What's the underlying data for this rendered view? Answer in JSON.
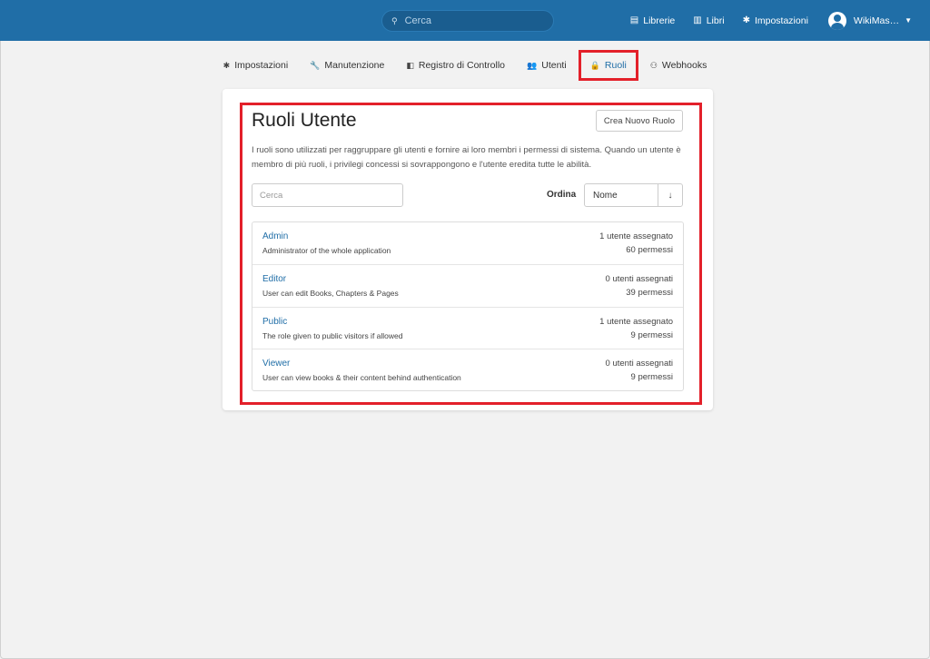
{
  "header": {
    "search_placeholder": "Cerca",
    "nav": [
      {
        "label": "Librerie",
        "icon": "library-icon",
        "glyph": "▤"
      },
      {
        "label": "Libri",
        "icon": "books-icon",
        "glyph": "▥"
      },
      {
        "label": "Impostazioni",
        "icon": "gear-icon",
        "glyph": "✱"
      }
    ],
    "user_name": "WikiMas…"
  },
  "subnav": [
    {
      "label": "Impostazioni",
      "icon": "gear-icon",
      "glyph": "✱"
    },
    {
      "label": "Manutenzione",
      "icon": "wrench-icon",
      "glyph": "🔧"
    },
    {
      "label": "Registro di Controllo",
      "icon": "audit-log-icon",
      "glyph": "◧"
    },
    {
      "label": "Utenti",
      "icon": "users-icon",
      "glyph": "👥"
    },
    {
      "label": "Ruoli",
      "icon": "lock-icon",
      "glyph": "🔒"
    },
    {
      "label": "Webhooks",
      "icon": "webhook-icon",
      "glyph": "⚇"
    }
  ],
  "page": {
    "title": "Ruoli Utente",
    "create_button": "Crea Nuovo Ruolo",
    "description": "I ruoli sono utilizzati per raggruppare gli utenti e fornire ai loro membri i permessi di sistema. Quando un utente è membro di più ruoli, i privilegi concessi si sovrappongono e l'utente eredita tutte le abilità.",
    "filter_placeholder": "Cerca",
    "sort_label": "Ordina",
    "sort_value": "Nome",
    "sort_direction": "↓"
  },
  "roles": [
    {
      "name": "Admin",
      "description": "Administrator of the whole application",
      "users": "1 utente assegnato",
      "permissions": "60 permessi"
    },
    {
      "name": "Editor",
      "description": "User can edit Books, Chapters & Pages",
      "users": "0 utenti assegnati",
      "permissions": "39 permessi"
    },
    {
      "name": "Public",
      "description": "The role given to public visitors if allowed",
      "users": "1 utente assegnato",
      "permissions": "9 permessi"
    },
    {
      "name": "Viewer",
      "description": "User can view books & their content behind authentication",
      "users": "0 utenti assegnati",
      "permissions": "9 permessi"
    }
  ],
  "colors": {
    "header": "#206ea7",
    "link": "#206ea7",
    "highlight": "#e3202a",
    "background": "#f2f2f2"
  }
}
